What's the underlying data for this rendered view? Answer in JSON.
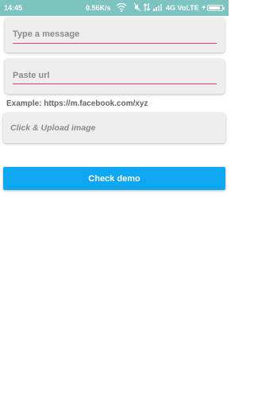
{
  "status_bar": {
    "time": "14:45",
    "network_speed": "0.56K/s",
    "carrier": "4G VoLTE",
    "charging_symbol": "+",
    "battery_level": 0.9,
    "icons": [
      "wifi-icon",
      "mute-icon",
      "data-arrows-icon",
      "signal-icon"
    ]
  },
  "form": {
    "message_placeholder": "Type a message",
    "url_placeholder": "Paste url",
    "url_example": "Example: https://m.facebook.com/xyz",
    "upload_label": "Click & Upload image",
    "demo_button_label": "Check demo"
  },
  "colors": {
    "status_bar": "#7dc4c0",
    "accent_underline": "#e0407a",
    "button": "#0ea8f2"
  }
}
